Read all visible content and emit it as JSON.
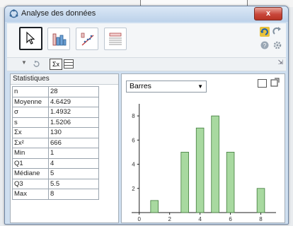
{
  "window": {
    "title": "Analyse des données",
    "close_label": "x"
  },
  "toolbar": {
    "tools": [
      "pointer-tool",
      "bar-chart-tool",
      "scatter-tool",
      "table-tool"
    ],
    "undo_icon": "undo-icon",
    "redo_icon": "redo-icon",
    "help_icon": "help-icon",
    "settings_icon": "gear-icon"
  },
  "subtoolbar": {
    "sigma_label": "Σx"
  },
  "stats": {
    "header": "Statistiques",
    "rows": [
      {
        "key": "n",
        "value": "28"
      },
      {
        "key": "Moyenne",
        "value": "4.6429"
      },
      {
        "key": "σ",
        "value": "1.4932"
      },
      {
        "key": "s",
        "value": "1.5206"
      },
      {
        "key": "Σx",
        "value": "130"
      },
      {
        "key": "Σx²",
        "value": "666"
      },
      {
        "key": "Min",
        "value": "1"
      },
      {
        "key": "Q1",
        "value": "4"
      },
      {
        "key": "Médiane",
        "value": "5"
      },
      {
        "key": "Q3",
        "value": "5.5"
      },
      {
        "key": "Max",
        "value": "8"
      }
    ]
  },
  "chart_panel": {
    "select_label": "Barres"
  },
  "chart_data": {
    "type": "bar",
    "x": [
      1,
      3,
      4,
      5,
      6,
      8
    ],
    "values": [
      1,
      5,
      7,
      8,
      5,
      2
    ],
    "xlim": [
      -0.5,
      9
    ],
    "ylim": [
      0,
      9
    ],
    "xticks": [
      "0",
      "2",
      "4",
      "6",
      "8"
    ],
    "yticks": [
      "2",
      "4",
      "6",
      "8"
    ],
    "bar_color": "#a8d9a0",
    "bar_stroke": "#3f7a3a"
  }
}
